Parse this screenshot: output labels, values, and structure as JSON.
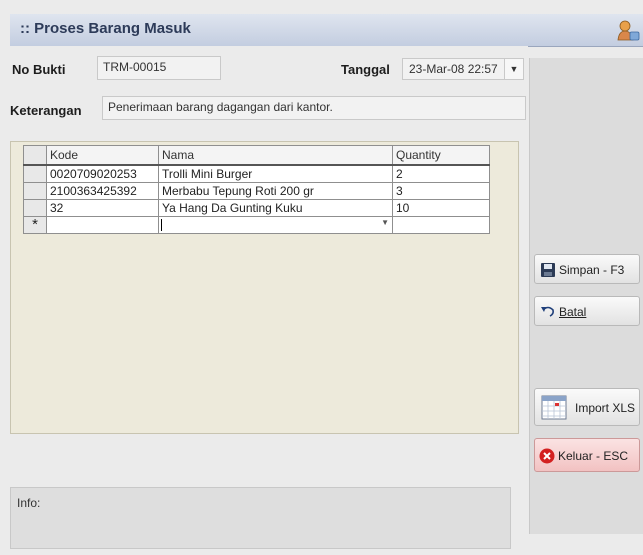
{
  "window": {
    "title": ":: Proses Barang Masuk"
  },
  "form": {
    "no_bukti_label": "No Bukti",
    "no_bukti_value": "TRM-00015",
    "tanggal_label": "Tanggal",
    "tanggal_value": "23-Mar-08 22:57",
    "keterangan_label": "Keterangan",
    "keterangan_value": "Penerimaan barang dagangan dari kantor."
  },
  "grid": {
    "columns": [
      "Kode",
      "Nama",
      "Quantity"
    ],
    "rows": [
      {
        "kode": "0020709020253",
        "nama": "Trolli Mini Burger",
        "qty": "2"
      },
      {
        "kode": "2100363425392",
        "nama": "Merbabu Tepung Roti 200 gr",
        "qty": "3"
      },
      {
        "kode": "32",
        "nama": "Ya Hang Da Gunting Kuku",
        "qty": "10"
      }
    ],
    "new_row_marker": "*"
  },
  "info": {
    "label": "Info:"
  },
  "buttons": {
    "simpan": "Simpan - F3",
    "batal": "Batal",
    "import": "Import XLS",
    "keluar": "Keluar - ESC"
  }
}
